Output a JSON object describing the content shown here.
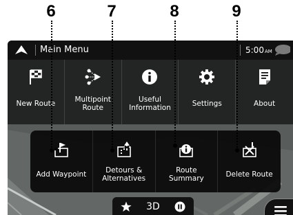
{
  "callouts": [
    "6",
    "7",
    "8",
    "9"
  ],
  "topbar": {
    "title": "Main Menu",
    "time": "5:00",
    "ampm": "AM"
  },
  "menu": {
    "items": [
      {
        "label": "New Route",
        "icon": "checkered-flag-icon"
      },
      {
        "label": "Multipoint\nRoute",
        "icon": "multipoint-route-icon"
      },
      {
        "label": "Useful\nInformation",
        "icon": "info-icon"
      },
      {
        "label": "Settings",
        "icon": "gear-icon"
      },
      {
        "label": "About",
        "icon": "document-icon"
      }
    ]
  },
  "submenu": {
    "items": [
      {
        "label": "Add Waypoint",
        "icon": "add-waypoint-icon"
      },
      {
        "label": "Detours &\nAlternatives",
        "icon": "detour-icon"
      },
      {
        "label": "Route\nSummary",
        "icon": "route-summary-icon"
      },
      {
        "label": "Delete Route",
        "icon": "delete-route-icon"
      }
    ]
  },
  "bottombar": {
    "view_mode": "3D",
    "icons": [
      "star-icon",
      "pause-icon"
    ]
  },
  "colors": {
    "topbar": "#111111",
    "menu_panel": "#141616",
    "submenu_panel": "#080808",
    "map": "#5a5e5c",
    "text": "#ffffff"
  }
}
